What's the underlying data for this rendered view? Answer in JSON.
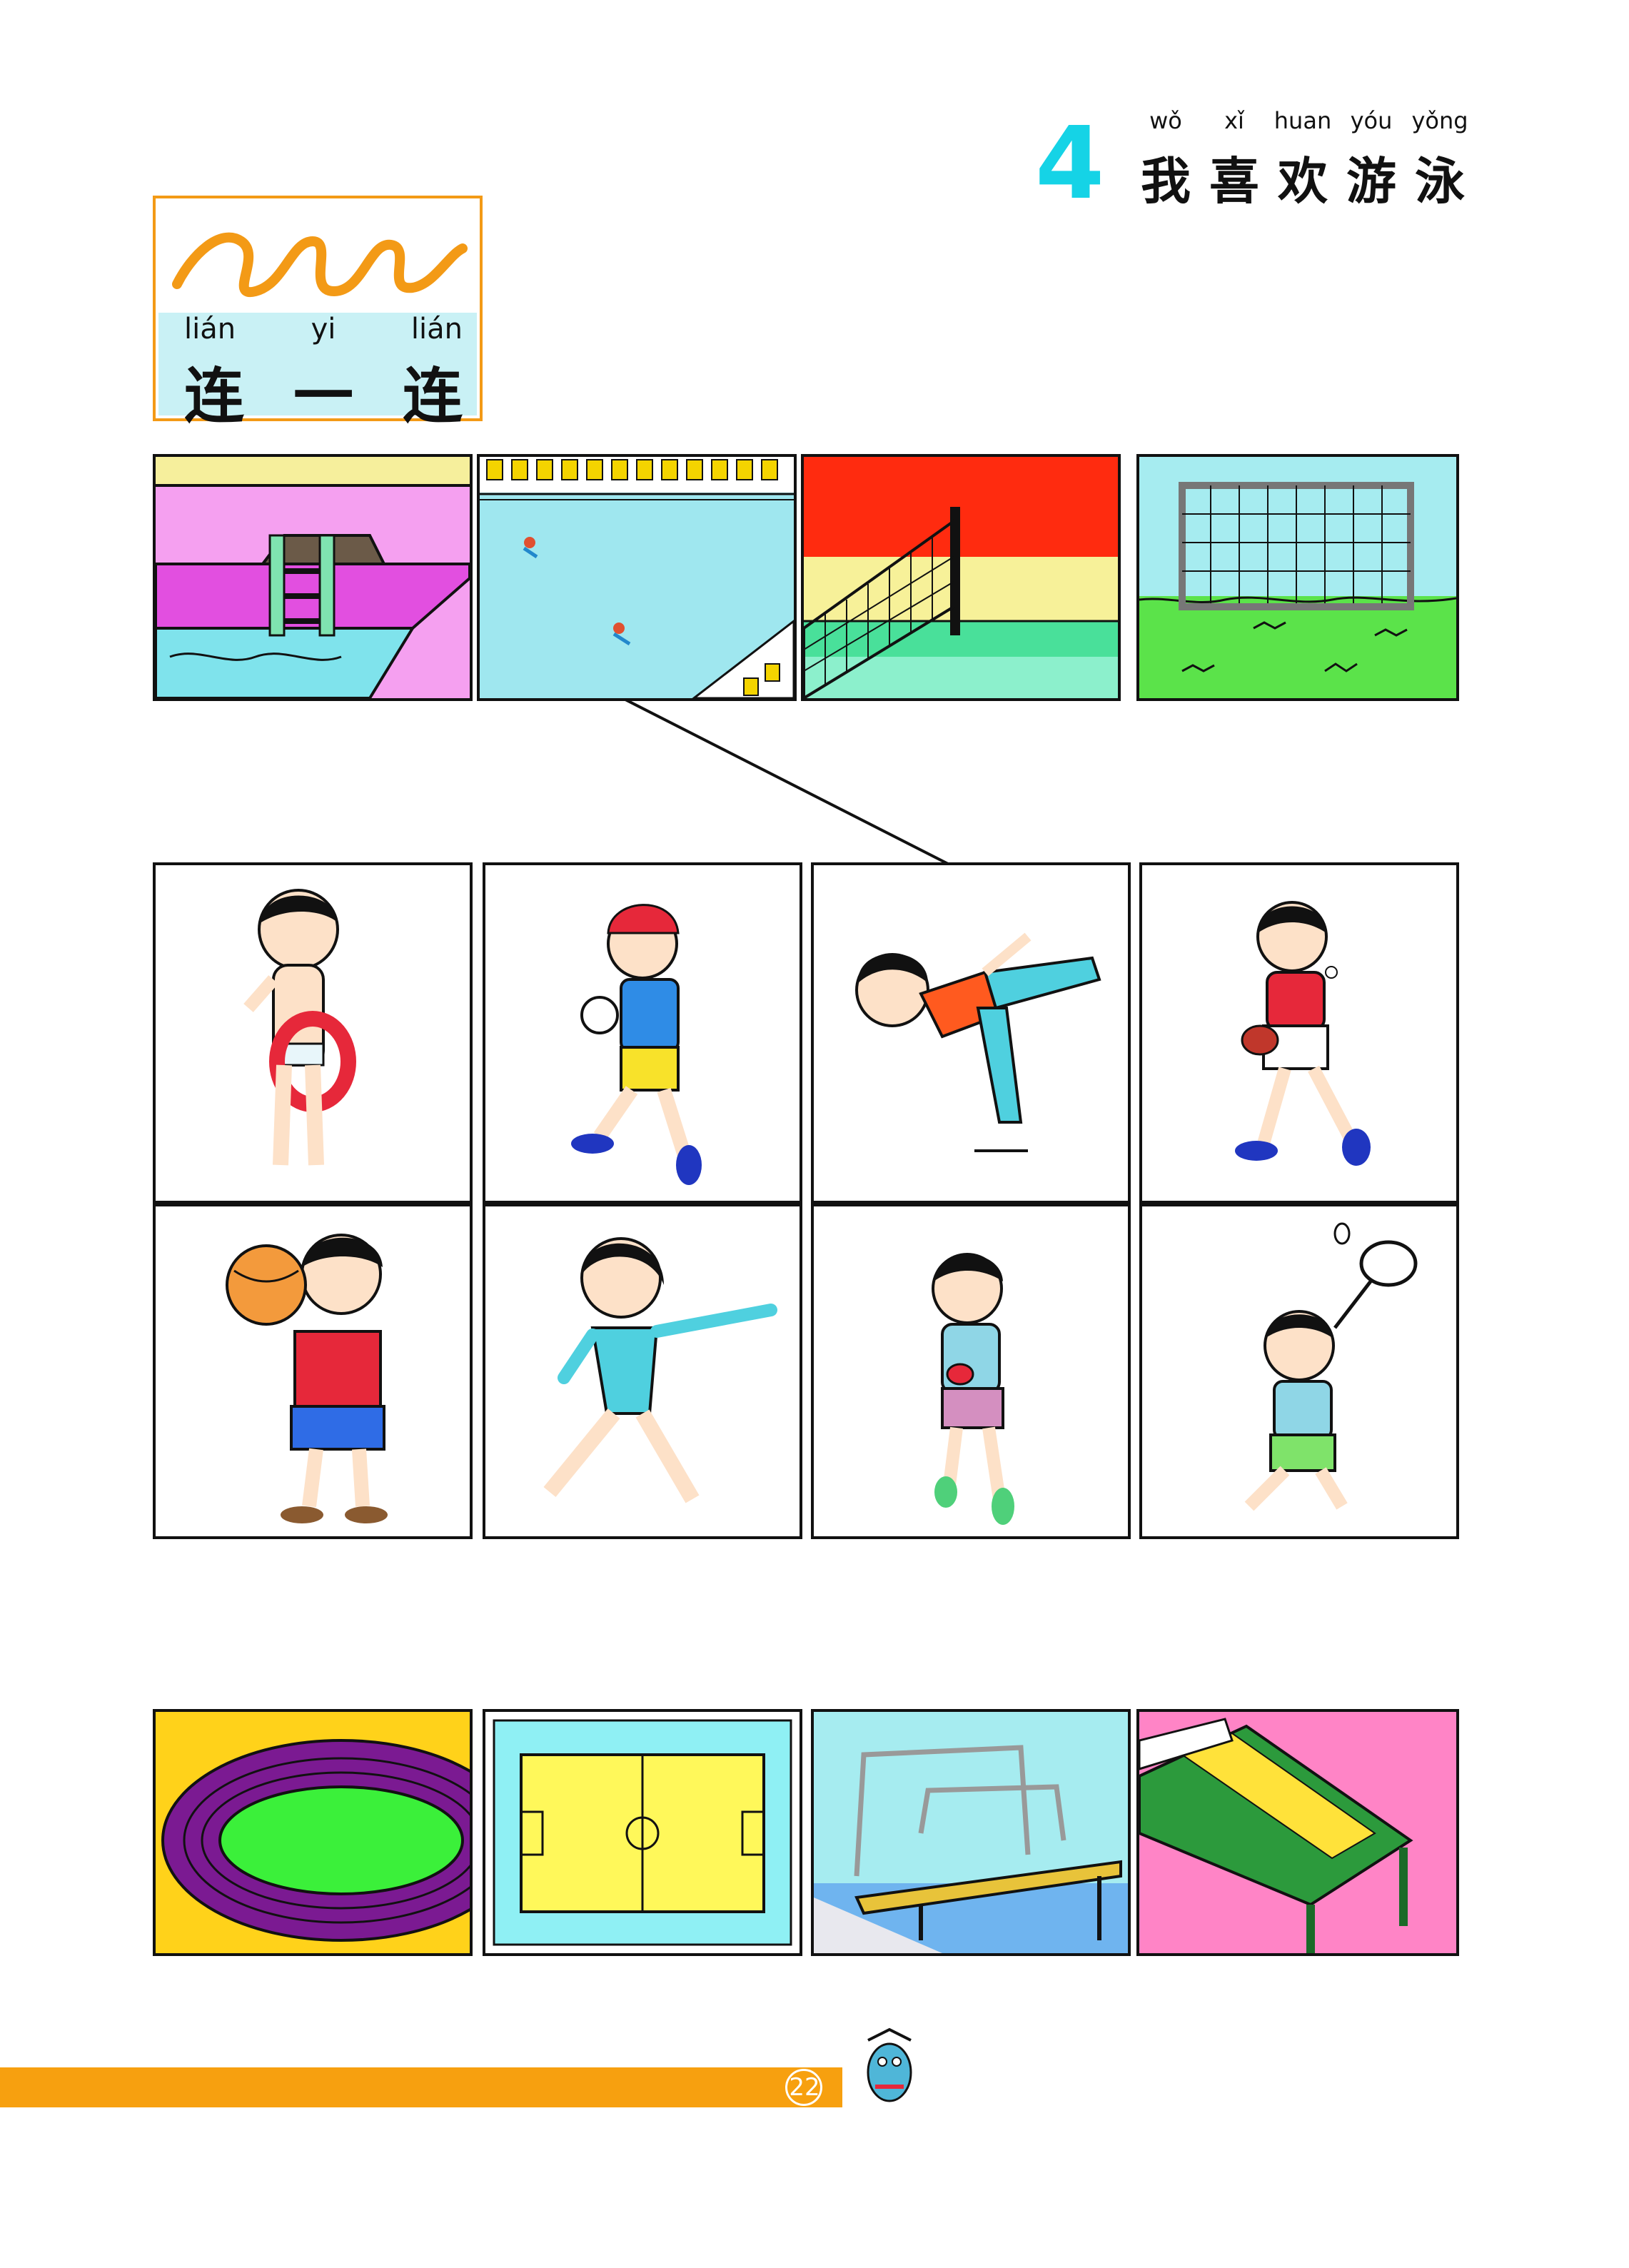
{
  "title": {
    "lesson_number": "4",
    "pinyin": [
      "wǒ",
      "xǐ",
      "huan",
      "yóu",
      "yǒng"
    ],
    "hanzi": [
      "我",
      "喜",
      "欢",
      "游",
      "泳"
    ]
  },
  "instruction": {
    "pinyin": [
      "lián",
      "yi",
      "lián"
    ],
    "hanzi": [
      "连",
      "一",
      "连"
    ]
  },
  "venues_top": [
    "swimming-pool",
    "ice-rink",
    "volleyball-court",
    "soccer-goal"
  ],
  "athletes_row1": [
    "swimmer",
    "soccer-player",
    "figure-skater",
    "table-tennis-player"
  ],
  "athletes_row2": [
    "basketball-player",
    "gymnast",
    "runner",
    "badminton-player"
  ],
  "venues_bottom": [
    "running-track",
    "soccer-field",
    "gymnastics-apparatus",
    "table-tennis-table"
  ],
  "connection_example": {
    "from": "ice-rink",
    "to": "figure-skater"
  },
  "page_number": "22",
  "colors": {
    "accent_orange": "#f7a00f",
    "title_cyan": "#15d3e6"
  }
}
